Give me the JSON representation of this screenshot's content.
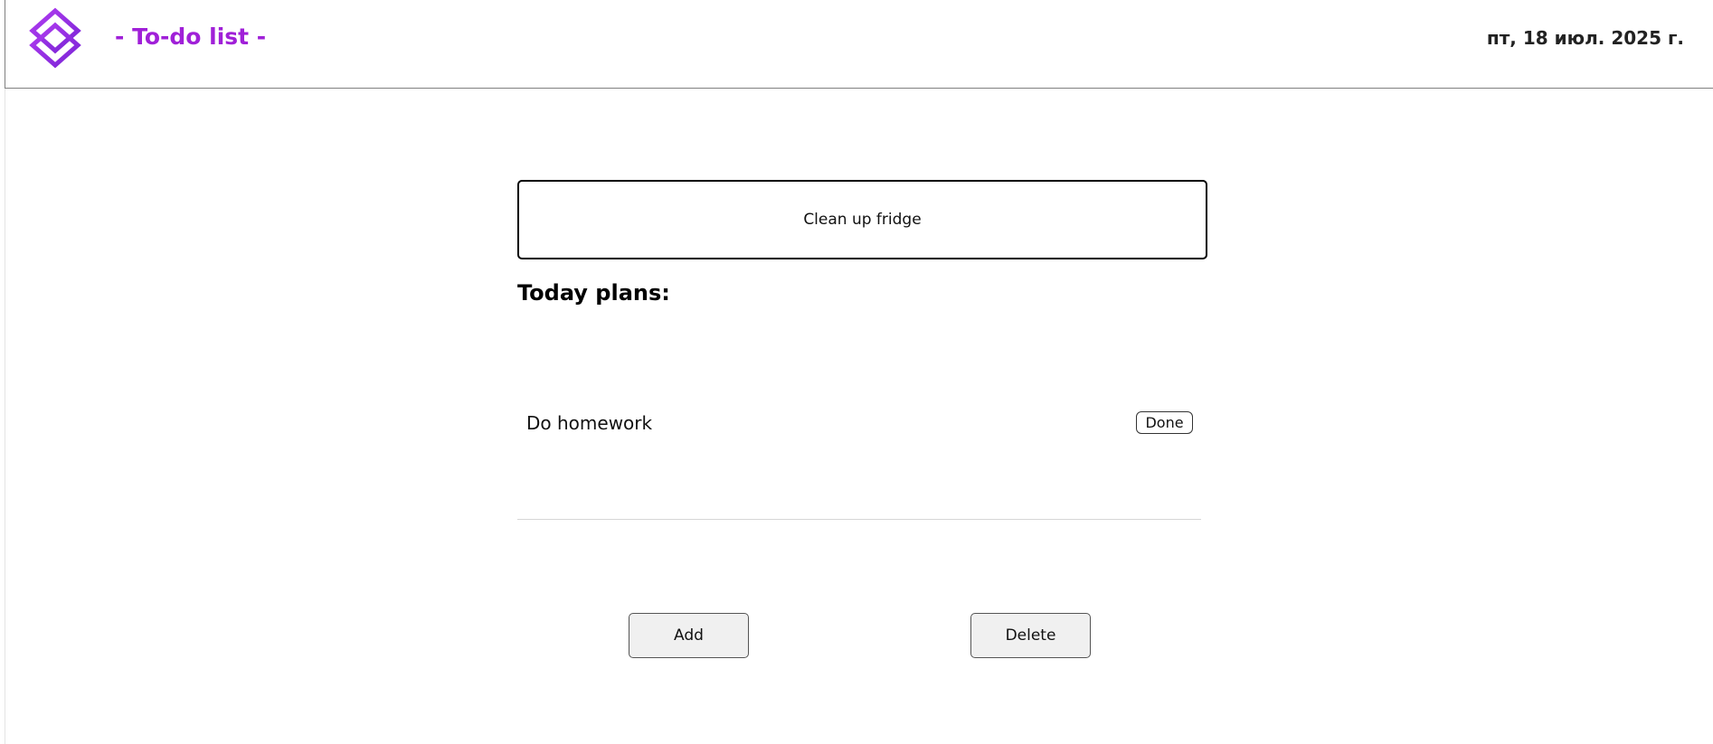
{
  "header": {
    "title": "- To-do list -",
    "date": "пт, 18 июл. 2025 г.",
    "logo_icon": "diamond-logo-icon",
    "accent_color": "#a020d8"
  },
  "new_task": {
    "value": "Clean up fridge"
  },
  "tasks_section": {
    "title": "Today plans:",
    "items": [
      {
        "label": "Do homework",
        "done_label": "Done"
      }
    ]
  },
  "actions": {
    "add_label": "Add",
    "delete_label": "Delete"
  }
}
